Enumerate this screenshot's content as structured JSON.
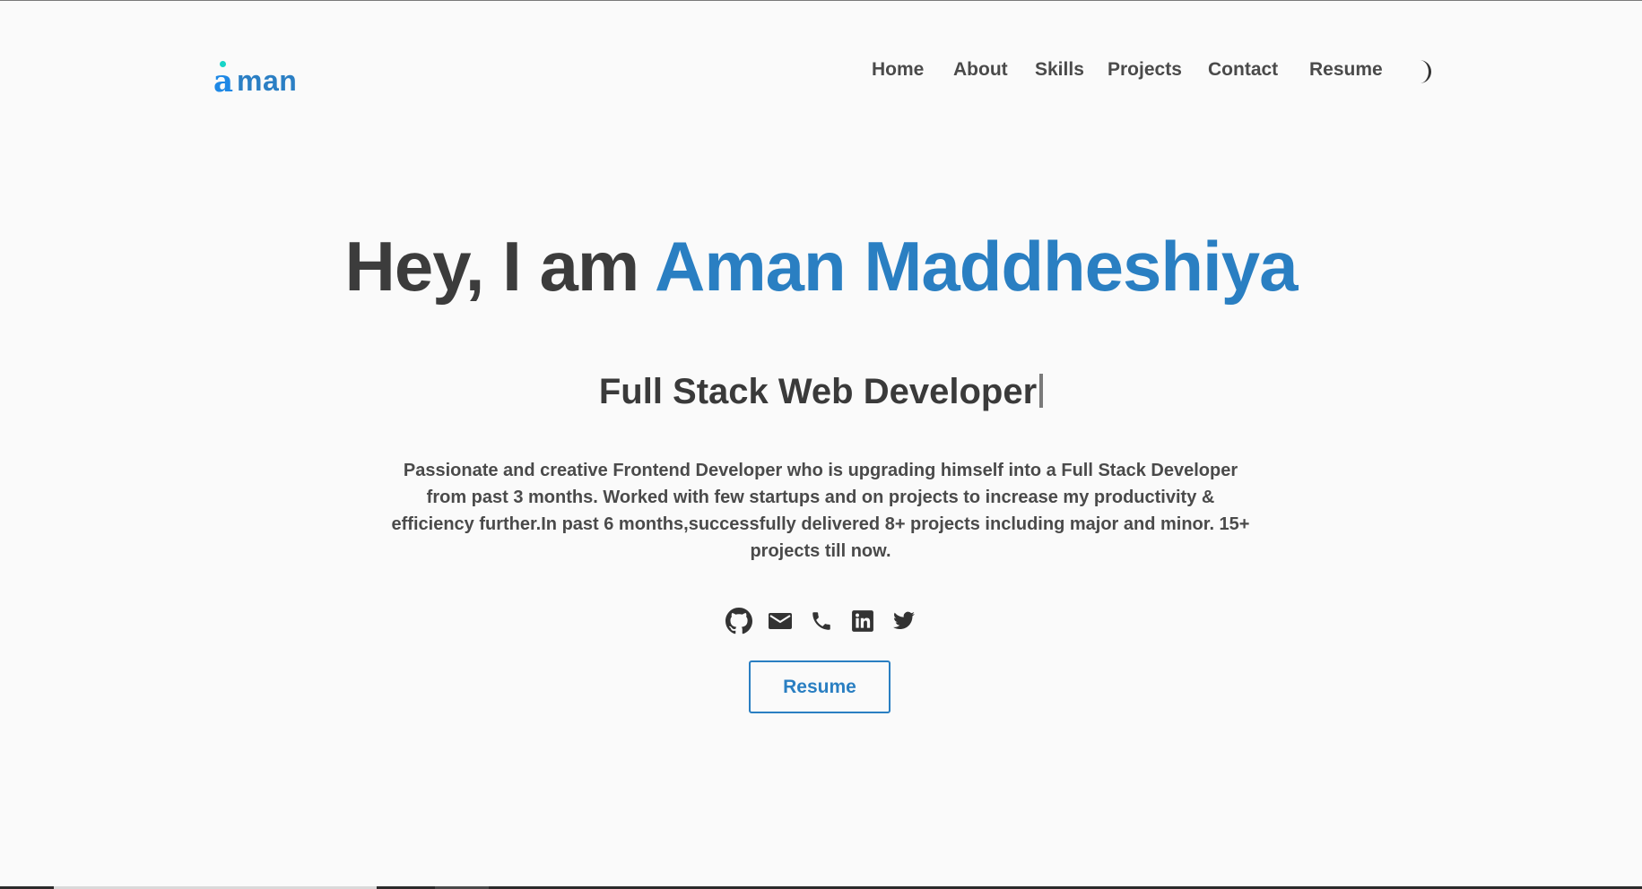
{
  "header": {
    "logo_text": "man",
    "logo_glyph": "a",
    "nav": [
      "Home",
      "About",
      "Skills",
      "Projects",
      "Contact",
      "Resume"
    ],
    "theme_toggle_icon": "moon-icon"
  },
  "hero": {
    "greeting": "Hey, I am",
    "name": "Aman Maddheshiya",
    "role": "Full Stack Web Developer",
    "description": "Passionate and creative Frontend Developer who is upgrading himself into a Full Stack Developer from past 3 months. Worked with few startups and on projects to increase my productivity & efficiency further.In past 6 months,successfully delivered 8+ projects including major and minor. 15+ projects till now.",
    "socials": [
      "github-icon",
      "email-icon",
      "phone-icon",
      "linkedin-icon",
      "twitter-icon"
    ],
    "resume_button": "Resume"
  },
  "colors": {
    "accent": "#2a7fc2",
    "text": "#444444",
    "background": "#fafafa",
    "logo_dot": "#17d4c7"
  }
}
